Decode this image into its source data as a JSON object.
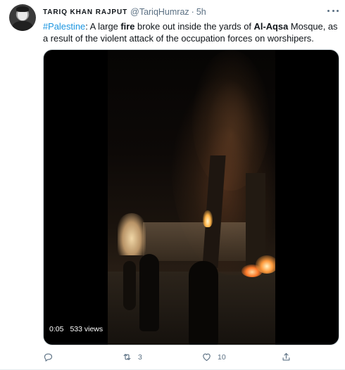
{
  "author": {
    "display_name": "TARIQ KHAN RAJPUT",
    "handle": "@TariqHumraz",
    "separator": "·",
    "time": "5h"
  },
  "tweet_text": {
    "hashtag": "#Palestine",
    "part1": ": A large ",
    "bold1": "fire",
    "part2": " broke out inside the yards of ",
    "bold2": "Al-Aqsa",
    "part3": " Mosque, as a result of the violent attack of the occupation forces on worshipers."
  },
  "video": {
    "timestamp": "0:05",
    "views": "533 views"
  },
  "actions": {
    "reply_count": "",
    "retweet_count": "3",
    "like_count": "10"
  },
  "icons": {
    "more": "more-icon",
    "reply": "reply-icon",
    "retweet": "retweet-icon",
    "like": "heart-icon",
    "share": "share-icon"
  },
  "colors": {
    "link": "#1b95e0",
    "secondary_text": "#5b7083",
    "primary_text": "#0f1419"
  }
}
